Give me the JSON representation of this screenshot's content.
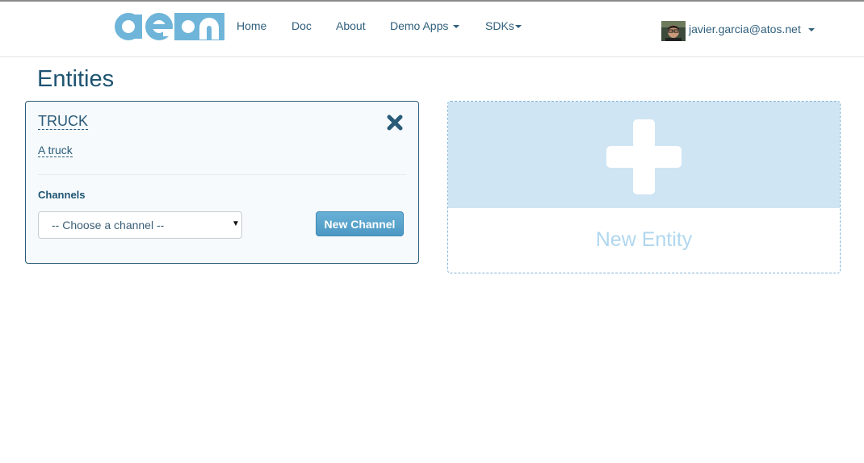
{
  "navbar": {
    "logo_text": "aeon",
    "links": [
      {
        "label": "Home"
      },
      {
        "label": "Doc"
      },
      {
        "label": "About"
      },
      {
        "label": "Demo Apps"
      },
      {
        "label": "SDKs"
      }
    ],
    "user": {
      "email": "javier.garcia@atos.net"
    }
  },
  "page": {
    "title": "Entities"
  },
  "entity": {
    "name": "TRUCK",
    "description": "A truck",
    "channels_label": "Channels",
    "channel_select": {
      "selected": "-- Choose a channel --"
    },
    "new_channel_label": "New Channel"
  },
  "new_entity": {
    "label": "New Entity"
  },
  "colors": {
    "primary": "#2a5b78",
    "accent": "#5aa4cd",
    "panel": "#cfe5f4",
    "new_entity_text": "#b0d7ee"
  }
}
